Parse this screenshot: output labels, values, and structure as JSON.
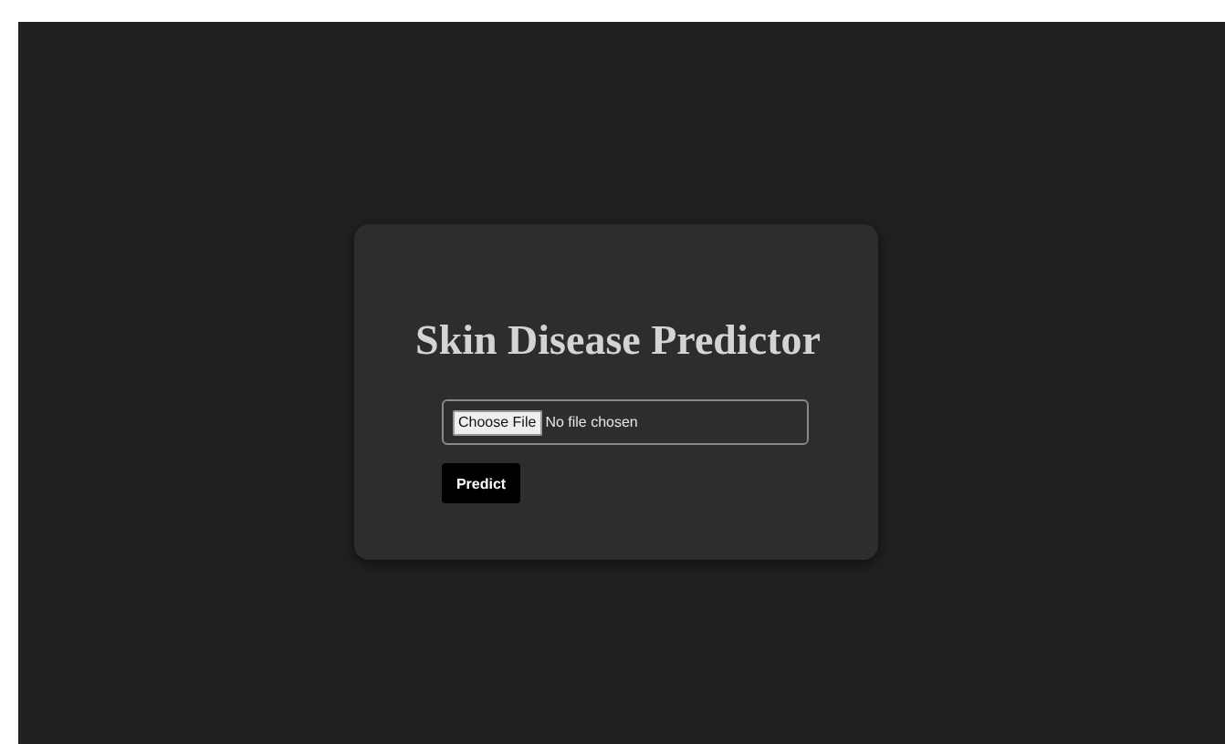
{
  "title": "Skin Disease Predictor",
  "file_input": {
    "button": "Choose File",
    "status": "No file chosen"
  },
  "submit_button": "Predict"
}
